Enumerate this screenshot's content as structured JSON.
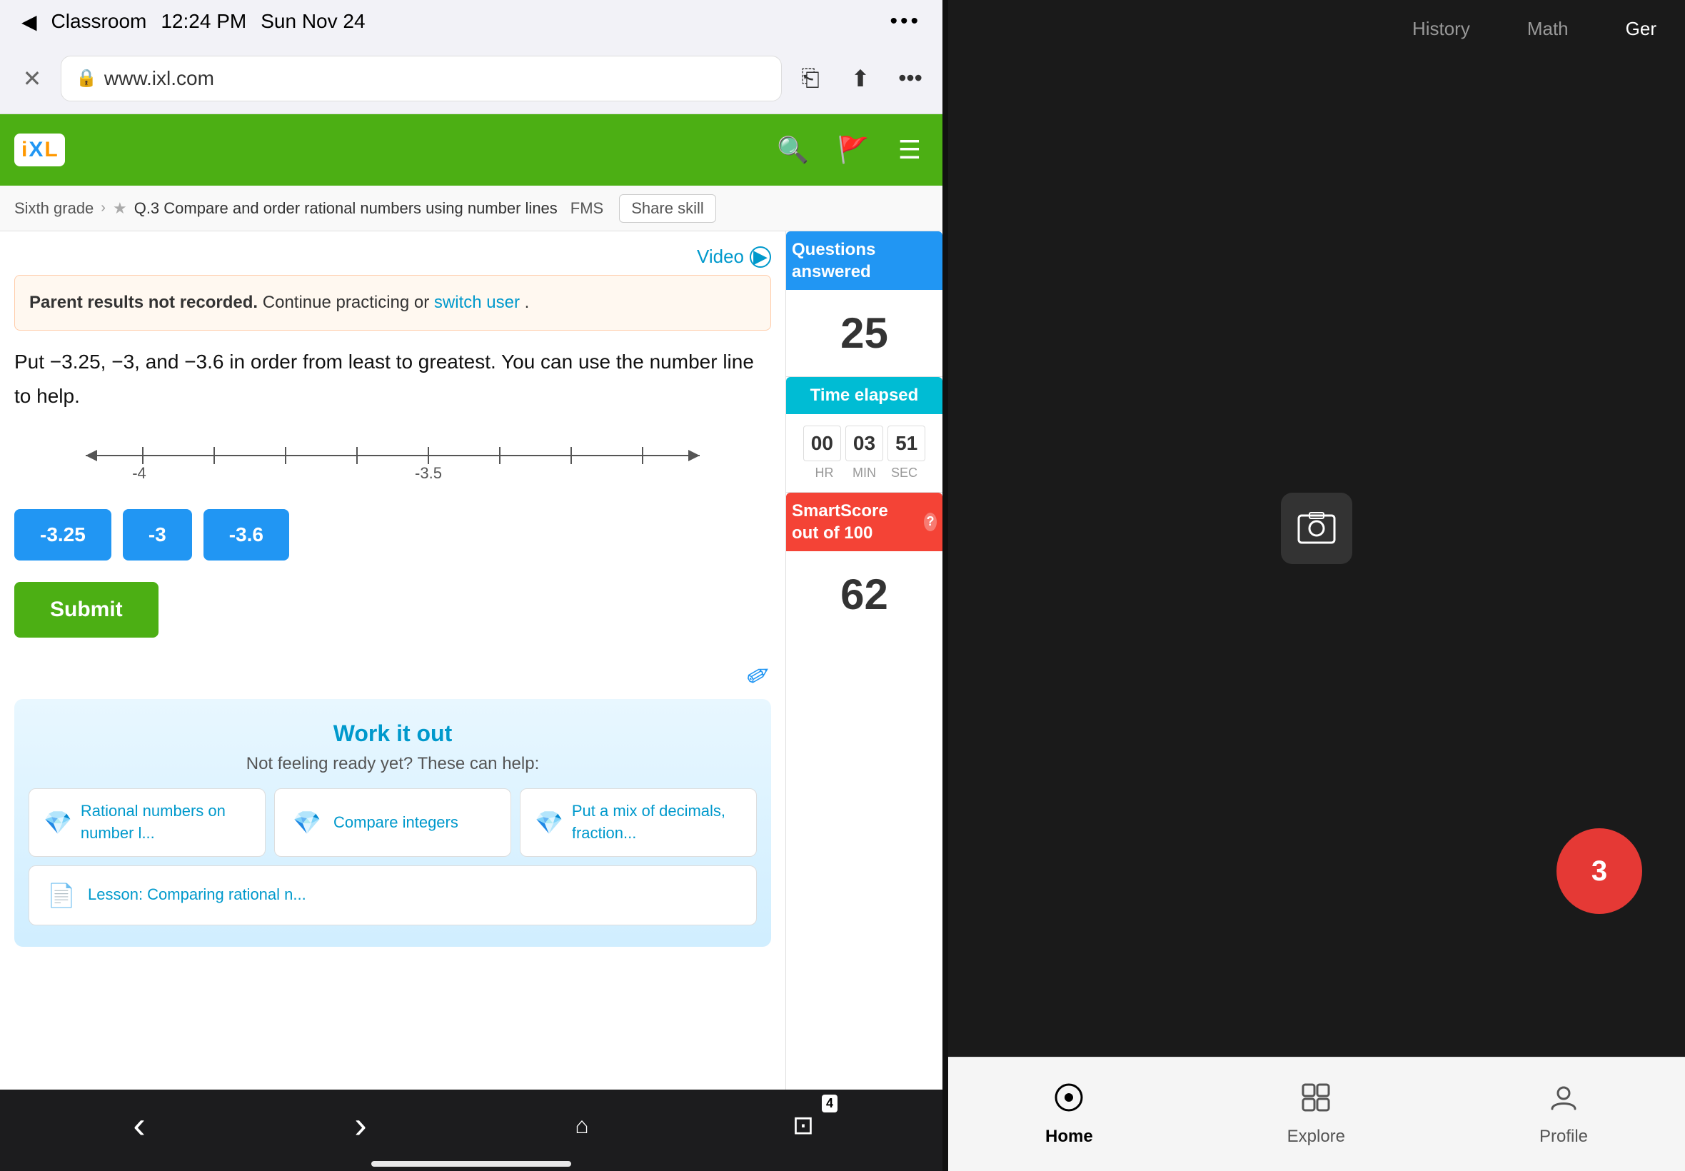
{
  "status_bar": {
    "back": "◀",
    "app_name": "Classroom",
    "time": "12:24 PM",
    "date": "Sun Nov 24",
    "dots": "•••"
  },
  "browser": {
    "close_label": "✕",
    "address": "www.ixl.com",
    "lock_icon": "🔒",
    "bookmark_icon": "⎋",
    "share_icon": "↑",
    "more_icon": "•••"
  },
  "ixl_header": {
    "logo_i": "i",
    "logo_x": "X",
    "logo_l": "L",
    "search_icon": "🔍",
    "flag_icon": "🚩",
    "menu_icon": "☰"
  },
  "breadcrumb": {
    "grade": "Sixth grade",
    "sep1": "›",
    "star": "★",
    "skill": "Q.3 Compare and order rational numbers using number lines",
    "fms": "FMS",
    "share": "Share skill"
  },
  "question_area": {
    "video_label": "Video",
    "notification": {
      "bold_text": "Parent results not recorded.",
      "rest": " Continue practicing or",
      "link": "switch user",
      "end": "."
    },
    "question": "Put −3.25, −3, and −3.6 in order from least to greatest. You can use the number line to help.",
    "number_line": {
      "left_label": "-4",
      "right_label": "-3.5"
    },
    "answers": [
      "-3.25",
      "-3",
      "-3.6"
    ],
    "submit_label": "Submit"
  },
  "work_it_out": {
    "title": "Work it out",
    "subtitle": "Not feeling ready yet? These can help:",
    "skills": [
      {
        "icon": "💎",
        "text": "Rational numbers on number l...",
        "color": "blue"
      },
      {
        "icon": "💎",
        "text": "Compare integers",
        "color": "blue"
      },
      {
        "icon": "💎",
        "text": "Put a mix of decimals, fraction...",
        "color": "blue"
      },
      {
        "icon": "📄",
        "text": "Lesson: Comparing rational n...",
        "color": "purple"
      }
    ]
  },
  "sidebar": {
    "questions_header": "Questions answered",
    "questions_number": "25",
    "time_header": "Time elapsed",
    "time": {
      "hr": "00",
      "min": "03",
      "sec": "51",
      "hr_label": "HR",
      "min_label": "MIN",
      "sec_label": "SEC"
    },
    "smart_header": "SmartScore out of 100",
    "smart_number": "62"
  },
  "browser_nav": {
    "back": "‹",
    "forward": "›",
    "home": "⌂",
    "tabs": "⧉",
    "tab_count": "4"
  },
  "app_subjects": {
    "history": "History",
    "math": "Math",
    "ger": "Ger"
  },
  "app_bottom_nav": {
    "home_icon": "⊙",
    "home_label": "Home",
    "explore_icon": "⊞",
    "explore_label": "Explore",
    "profile_icon": "☺",
    "profile_label": "Profile"
  }
}
